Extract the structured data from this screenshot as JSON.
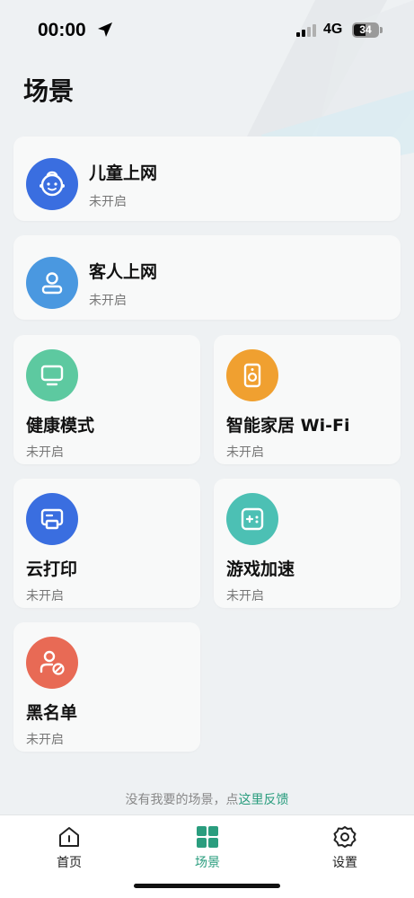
{
  "status_bar": {
    "time": "00:00",
    "network": "4G",
    "battery": "34"
  },
  "page": {
    "title": "场景"
  },
  "scenes": [
    {
      "title": "儿童上网",
      "status": "未开启",
      "icon": "child-face-icon",
      "color": "#3a6ee0"
    },
    {
      "title": "客人上网",
      "status": "未开启",
      "icon": "guest-user-icon",
      "color": "#4a98e0"
    },
    {
      "title": "健康模式",
      "status": "未开启",
      "icon": "monitor-icon",
      "color": "#5dc9a0"
    },
    {
      "title": "智能家居 Wi-Fi",
      "status": "未开启",
      "icon": "speaker-icon",
      "color": "#f0a030"
    },
    {
      "title": "云打印",
      "status": "未开启",
      "icon": "printer-icon",
      "color": "#3a6ee0"
    },
    {
      "title": "游戏加速",
      "status": "未开启",
      "icon": "gamepad-icon",
      "color": "#4cc0b4"
    },
    {
      "title": "黑名单",
      "status": "未开启",
      "icon": "blocked-user-icon",
      "color": "#e86a55"
    }
  ],
  "feedback": {
    "prefix": "没有我要的场景，点",
    "link": "这里反馈"
  },
  "tabs": [
    {
      "label": "首页",
      "icon": "home-icon"
    },
    {
      "label": "场景",
      "icon": "grid-icon",
      "active": true
    },
    {
      "label": "设置",
      "icon": "gear-icon"
    }
  ],
  "colors": {
    "accent": "#2a9d7e",
    "background": "#eef1f3",
    "card": "#f8f9f9"
  }
}
